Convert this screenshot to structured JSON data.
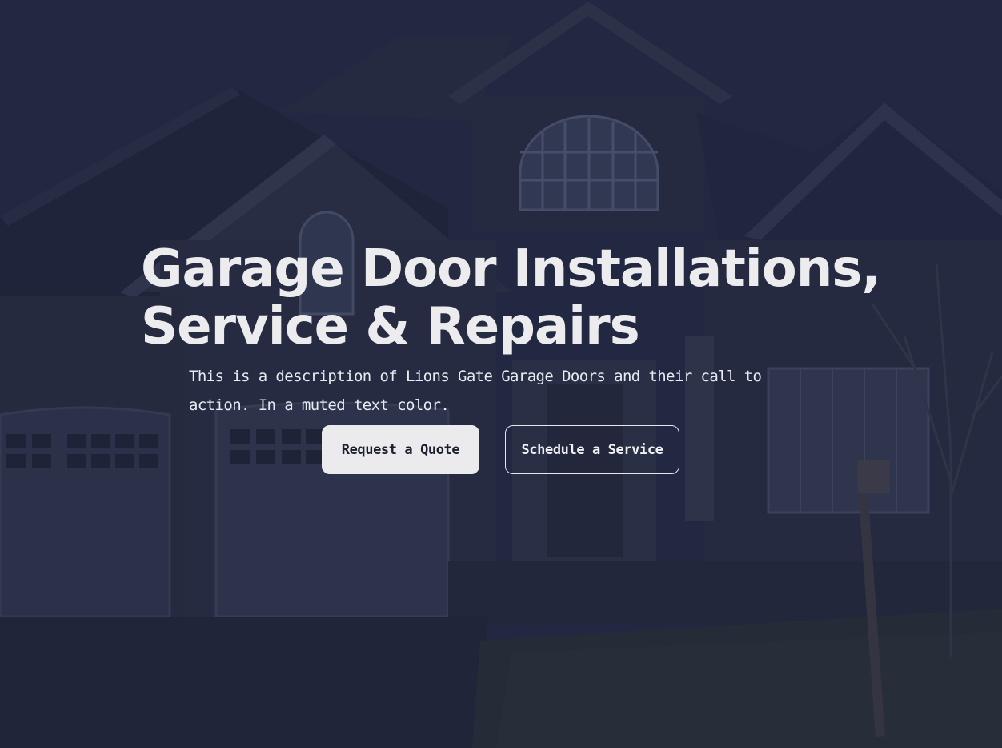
{
  "hero": {
    "background_image": "house-with-garage-photo",
    "headline_line1": "Garage Door Installations,",
    "headline_line2": "Service & Repairs",
    "description": "This is a description of Lions Gate Garage Doors and their call to action. In a muted text color.",
    "primary_button_label": "Request a Quote",
    "secondary_button_label": "Schedule a Service"
  },
  "colors": {
    "overlay": "#1c223a",
    "headline_text": "#ececef",
    "description_text": "#e6ecf2",
    "primary_button_bg": "#ebebee",
    "primary_button_text": "#1b1f2e",
    "secondary_button_border": "#e6e7ec"
  }
}
